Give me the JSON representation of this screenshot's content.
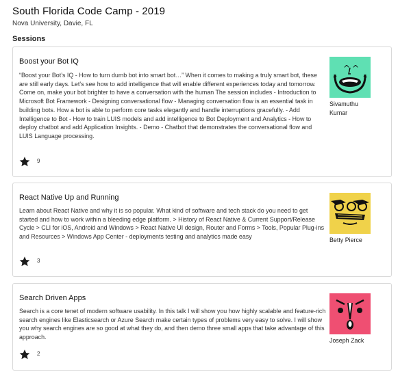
{
  "event": {
    "title": "South Florida Code Camp - 2019",
    "venue": "Nova University, Davie, FL"
  },
  "sessions_heading": "Sessions",
  "sessions": [
    {
      "title": "Boost your Bot IQ",
      "description": "“Boost your Bot’s IQ - How to turn dumb bot into smart bot…” When it comes to making a truly smart bot, these are still early days. Let’s see how to add intelligence that will enable different experiences today and tomorrow. Come on, make your bot brighter to have a conversation with the human The session includes - Introduction to Microsoft Bot Framework - Designing conversational flow - Managing conversation flow is an essential task in building bots. How a bot is able to perform core tasks elegantly and handle interruptions gracefully. - Add Intelligence to Bot - How to train LUIS models and add intelligence to Bot Deployment and Analytics - How to deploy chatbot and add Application Insights. - Demo - Chatbot that demonstrates the conversational flow and LUIS Language processing.",
      "speaker": "Sivamuthu Kumar",
      "votes": "9",
      "avatar_color": "#5fe0b3",
      "star_icon": "star-icon"
    },
    {
      "title": "React Native Up and Running",
      "description": "Learn about React Native and why it is so popular. What kind of software and tech stack do you need to get started and how to work within a bleeding edge platform. > History of React Native & Current Support/Release Cycle > CLI for iOS, Android and Windows > React Native UI design, Router and Forms > Tools, Popular Plug-ins and Resources > Windows App Center - deployments testing and analytics made easy",
      "speaker": "Betty Pierce",
      "votes": "3",
      "avatar_color": "#f0d24a",
      "star_icon": "star-icon"
    },
    {
      "title": "Search Driven Apps",
      "description": "Search is a core tenet of modern software usability. In this talk I will show you how highly scalable and feature-rich search engines like Elasticsearch or Azure Search make certain types of problems very easy to solve. I will show you why search engines are so good at what they do, and then demo three small apps that take advantage of this approach.",
      "speaker": "Joseph Zack",
      "votes": "2",
      "avatar_color": "#ef4f72",
      "star_icon": "star-icon"
    }
  ]
}
